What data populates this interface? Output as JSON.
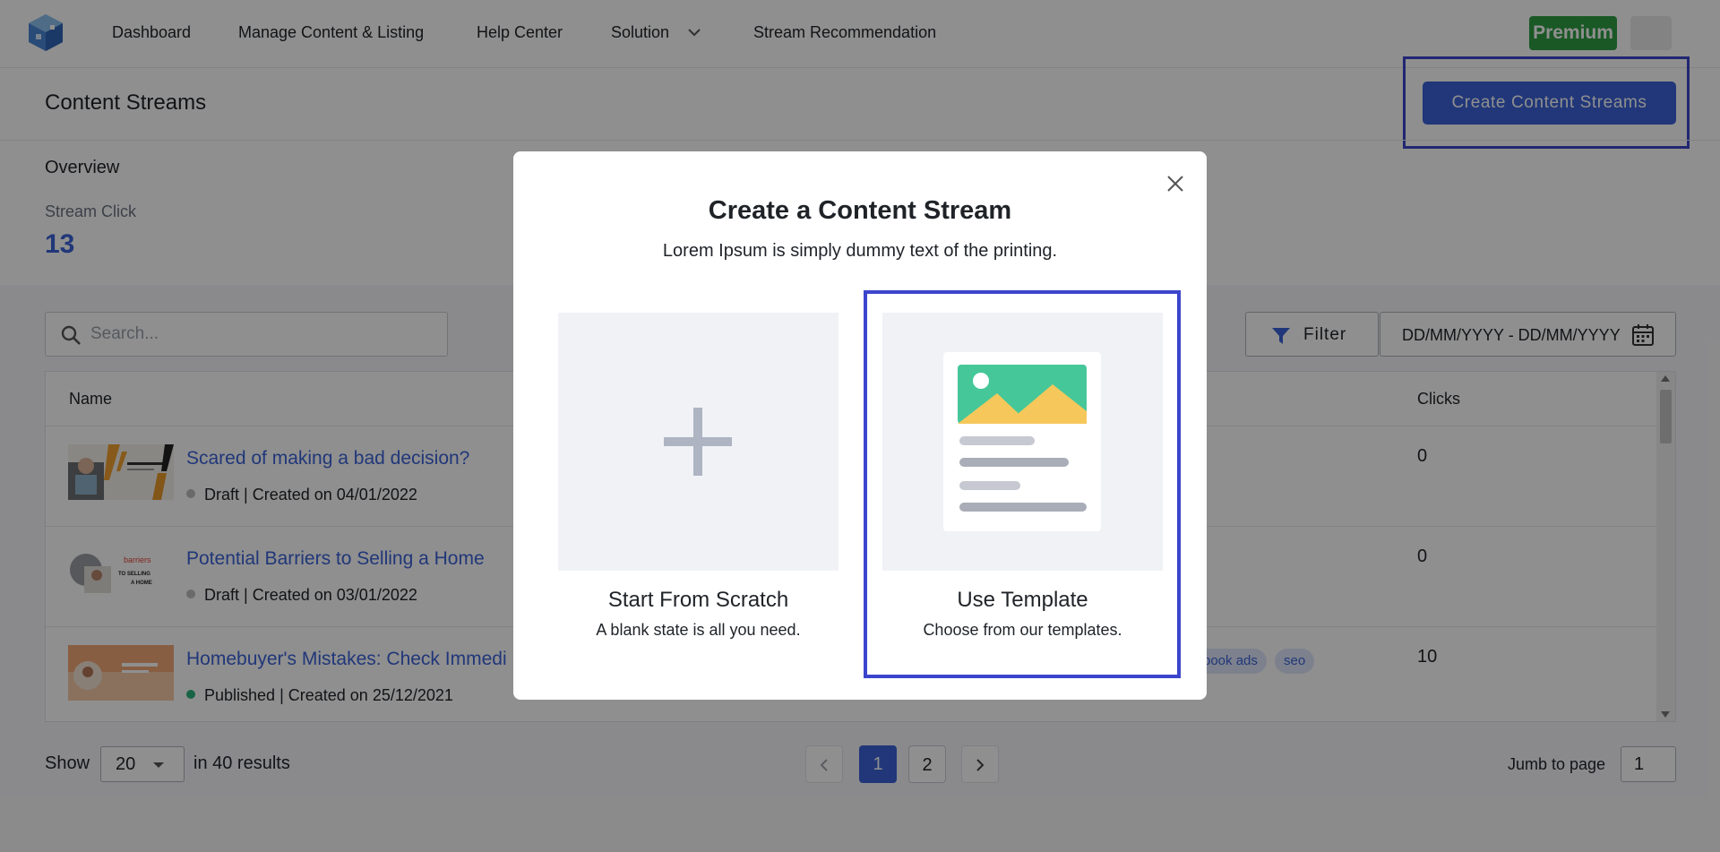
{
  "nav": {
    "items": [
      "Dashboard",
      "Manage Content & Listing",
      "Help Center",
      "Solution",
      "Stream Recommendation"
    ],
    "premium_label": "Premium"
  },
  "header": {
    "title": "Content Streams",
    "create_button": "Create Content Streams"
  },
  "overview": {
    "title": "Overview",
    "stat_label": "Stream Click",
    "stat_value": "13"
  },
  "toolbar": {
    "search_placeholder": "Search...",
    "filter_label": "Filter",
    "date_placeholder": "DD/MM/YYYY - DD/MM/YYYY"
  },
  "table": {
    "columns": [
      "Name",
      "Clicks"
    ],
    "rows": [
      {
        "title": "Scared of making a bad decision?",
        "status": "Draft",
        "meta": "| Created on 04/01/2022",
        "clicks": "0"
      },
      {
        "title": "Potential Barriers to Selling a Home",
        "status": "Draft",
        "meta": "| Created on 03/01/2022",
        "clicks": "0"
      },
      {
        "title": "Homebuyer's Mistakes: Check Immedi",
        "status": "Published",
        "meta": "| Created on 25/12/2021",
        "clicks": "10",
        "tags": [
          "book ads",
          "seo"
        ]
      }
    ],
    "thumb2_text": [
      "barriers",
      "TO SELLING",
      "A HOME"
    ]
  },
  "footer": {
    "show_label": "Show",
    "page_size": "20",
    "results_text": "in 40 results",
    "pages": [
      "1",
      "2"
    ],
    "jump_label": "Jumb to page",
    "jump_value": "1"
  },
  "modal": {
    "title": "Create a Content Stream",
    "subtitle": "Lorem Ipsum is simply dummy text of the printing.",
    "options": [
      {
        "title": "Start From Scratch",
        "subtitle": "A blank state is all you need."
      },
      {
        "title": "Use Template",
        "subtitle": "Choose from our templates."
      }
    ]
  },
  "colors": {
    "accent": "#3b63d8",
    "premium": "#2f9e44",
    "highlight": "#3b45cc",
    "draft_dot": "#bdbdbd",
    "published_dot": "#2fb37d"
  }
}
